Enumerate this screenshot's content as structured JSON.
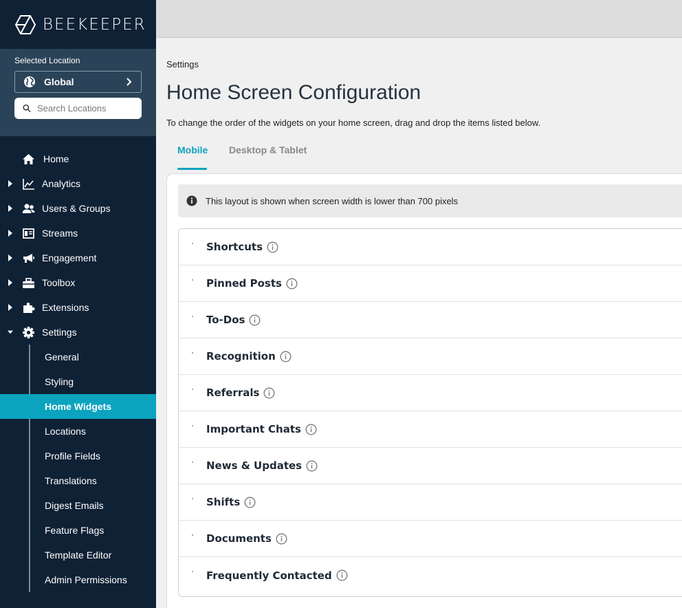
{
  "brand": {
    "name": "BEEKEEPER"
  },
  "location": {
    "label": "Selected Location",
    "selected": "Global",
    "search_placeholder": "Search Locations"
  },
  "nav": {
    "items": [
      {
        "label": "Home",
        "icon": "home-icon"
      },
      {
        "label": "Analytics",
        "icon": "chart-icon"
      },
      {
        "label": "Users & Groups",
        "icon": "users-icon"
      },
      {
        "label": "Streams",
        "icon": "streams-icon"
      },
      {
        "label": "Engagement",
        "icon": "megaphone-icon"
      },
      {
        "label": "Toolbox",
        "icon": "toolbox-icon"
      },
      {
        "label": "Extensions",
        "icon": "puzzle-icon"
      },
      {
        "label": "Settings",
        "icon": "gear-icon"
      }
    ],
    "settings_sub": [
      "General",
      "Styling",
      "Home Widgets",
      "Locations",
      "Profile Fields",
      "Translations",
      "Digest Emails",
      "Feature Flags",
      "Template Editor",
      "Admin Permissions"
    ],
    "active_sub": "Home Widgets"
  },
  "page": {
    "breadcrumb": "Settings",
    "title": "Home Screen Configuration",
    "description": "To change the order of the widgets on your home screen, drag and drop the items listed below.",
    "tabs": [
      "Mobile",
      "Desktop & Tablet"
    ],
    "active_tab": "Mobile",
    "info": "This layout is shown when screen width is lower than 700 pixels",
    "widgets": [
      "Shortcuts",
      "Pinned Posts",
      "To-Dos",
      "Recognition",
      "Referrals",
      "Important Chats",
      "News & Updates",
      "Shifts",
      "Documents",
      "Frequently Contacted"
    ]
  },
  "colors": {
    "sidebar_bg": "#0f2135",
    "location_panel_bg": "#2b4358",
    "accent": "#0ba3be"
  }
}
